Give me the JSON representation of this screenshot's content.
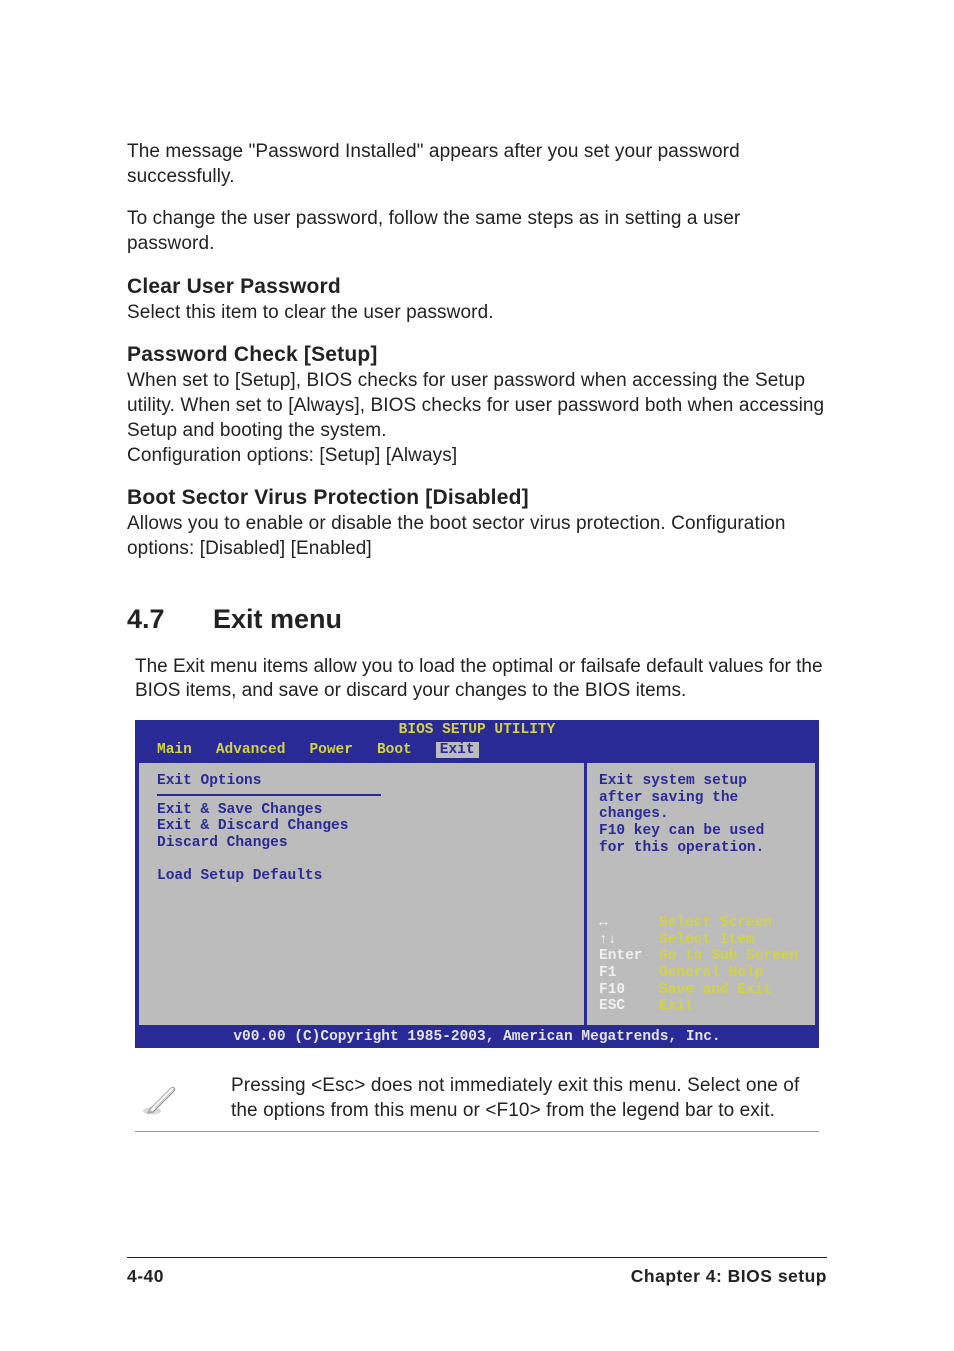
{
  "body": {
    "p1": "The message \"Password Installed\" appears after you set your password successfully.",
    "p2": "To change the user password, follow the same steps as in setting a user password.",
    "h1": "Clear User Password",
    "p3": "Select this item to clear the user password.",
    "h2": "Password Check [Setup]",
    "p4": "When set to [Setup], BIOS checks for user password when accessing the Setup utility. When set to [Always], BIOS checks for user password both when accessing Setup and booting the system.",
    "p4b": "Configuration options: [Setup] [Always]",
    "h3": "Boot Sector Virus Protection [Disabled]",
    "p5": "Allows you to enable or disable the boot sector virus protection. Configuration options: [Disabled] [Enabled]"
  },
  "section": {
    "num": "4.7",
    "title": "Exit menu",
    "intro": "The Exit menu items allow you to load the optimal or failsafe default values for the BIOS items, and save or discard your changes to the BIOS items."
  },
  "bios": {
    "title": "BIOS SETUP UTILITY",
    "tabs": [
      "Main",
      "Advanced",
      "Power",
      "Boot",
      "Exit"
    ],
    "selected_tab": "Exit",
    "left": {
      "header": "Exit Options",
      "items": [
        "Exit & Save Changes",
        "Exit & Discard Changes",
        "Discard Changes",
        "",
        "Load Setup Defaults"
      ]
    },
    "right": {
      "help_lines": [
        "Exit system setup",
        "after saving the",
        "changes.",
        "F10 key can be used",
        "for this operation."
      ],
      "nav": [
        {
          "key": "↔",
          "label": "Select Screen"
        },
        {
          "key": "↑↓",
          "label": "Select Item"
        },
        {
          "key": "Enter",
          "label": "Go to Sub Screen"
        },
        {
          "key": "F1",
          "label": "General Help"
        },
        {
          "key": "F10",
          "label": "Save and Exit"
        },
        {
          "key": "ESC",
          "label": "Exit"
        }
      ]
    },
    "footer": "v00.00 (C)Copyright 1985-2003, American Megatrends, Inc."
  },
  "note": {
    "text": "Pressing <Esc> does not immediately exit this menu. Select one of the options from this menu or <F10> from the legend bar to exit."
  },
  "footer": {
    "left": "4-40",
    "right": "Chapter 4: BIOS setup"
  }
}
